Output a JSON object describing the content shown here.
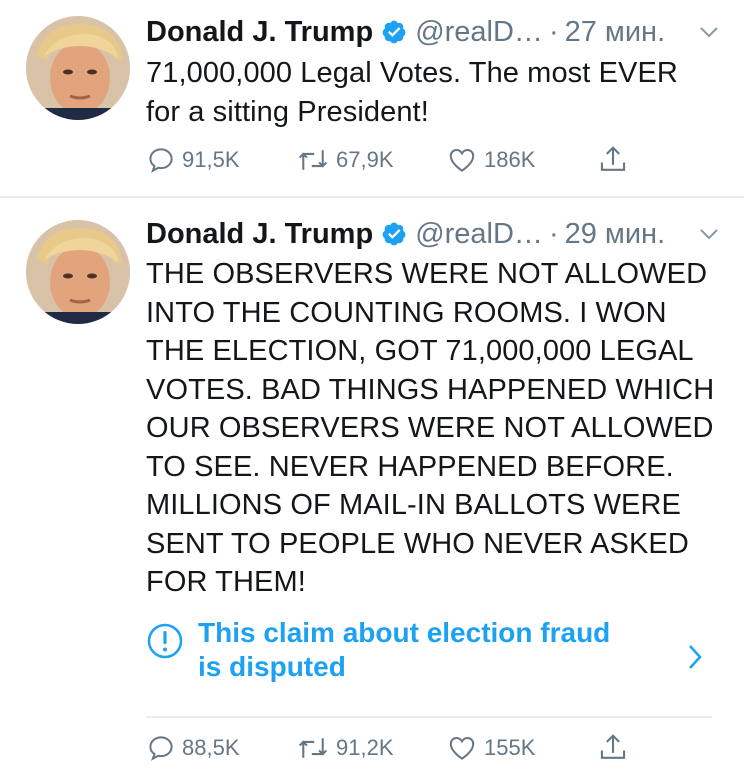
{
  "tweets": [
    {
      "author_name": "Donald J. Trump",
      "handle": "@realD…",
      "dot": "·",
      "time": "27 мин.",
      "lines": [
        "71,000,000 Legal Votes. The most EVER",
        "for a sitting President!"
      ],
      "replies": "91,5K",
      "retweets": "67,9K",
      "likes": "186K"
    },
    {
      "author_name": "Donald J. Trump",
      "handle": "@realD…",
      "dot": "·",
      "time": "29 мин.",
      "lines": [
        "THE OBSERVERS WERE NOT ALLOWED",
        "INTO THE COUNTING ROOMS. I WON",
        "THE ELECTION, GOT 71,000,000 LEGAL",
        "VOTES. BAD THINGS HAPPENED WHICH",
        "OUR OBSERVERS WERE NOT ALLOWED",
        "TO SEE. NEVER HAPPENED BEFORE.",
        "MILLIONS OF MAIL-IN BALLOTS WERE",
        "SENT TO PEOPLE WHO NEVER ASKED",
        "FOR THEM!"
      ],
      "notice": {
        "line1": "This claim about election fraud",
        "line2": "is disputed"
      },
      "replies": "88,5K",
      "retweets": "91,2K",
      "likes": "155K"
    }
  ],
  "colors": {
    "accent": "#1da1f2",
    "secondary_text": "#657786",
    "divider": "#e6ecf0"
  },
  "icons": {
    "verified": "verified-badge-icon",
    "reply": "reply-icon",
    "retweet": "retweet-icon",
    "like": "heart-icon",
    "share": "share-icon",
    "menu": "chevron-down-icon",
    "notice": "exclamation-circle-icon",
    "notice_arrow": "chevron-right-icon"
  }
}
